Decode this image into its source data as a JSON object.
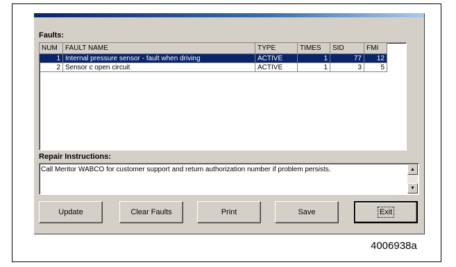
{
  "faults_label": "Faults:",
  "columns": [
    "NUM",
    "FAULT NAME",
    "TYPE",
    "TIMES",
    "SID",
    "FMI"
  ],
  "rows": [
    {
      "num": "1",
      "name": "Internal pressure sensor - fault when driving",
      "type": "ACTIVE",
      "times": "1",
      "sid": "77",
      "fmi": "12",
      "selected": true
    },
    {
      "num": "2",
      "name": "Sensor c open circuit",
      "type": "ACTIVE",
      "times": "1",
      "sid": "3",
      "fmi": "5",
      "selected": false
    }
  ],
  "repair_label": "Repair Instructions:",
  "repair_text": "Call Meritor WABCO for customer support and return authorization number if problem persists.",
  "buttons": {
    "update": "Update",
    "clear_faults": "Clear Faults",
    "print": "Print",
    "save": "Save",
    "exit": "Exit"
  },
  "figure_id": "4006938a",
  "colors": {
    "selection": "#0a246a",
    "window": "#d4d0c8"
  }
}
